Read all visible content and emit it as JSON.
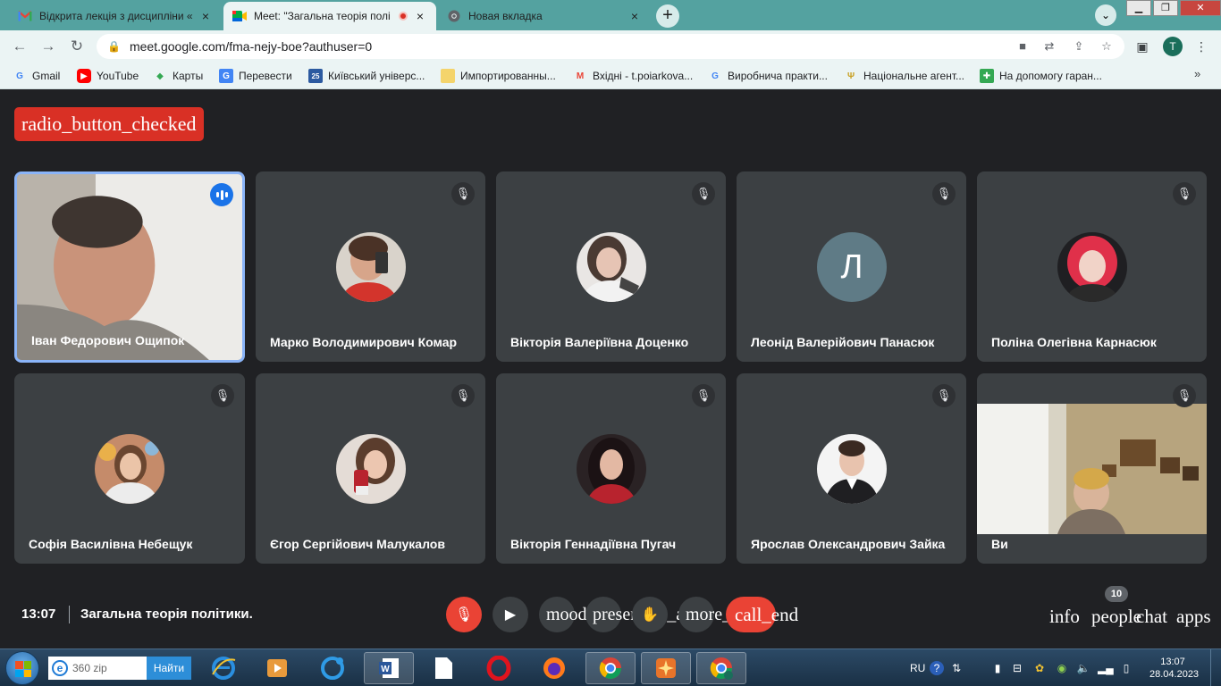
{
  "browser": {
    "tabs": [
      {
        "title": "Відкрита лекція з дисципліни «З",
        "close": "×"
      },
      {
        "title": "Meet: \"Загальна теорія полі",
        "close": "×"
      },
      {
        "title": "Новая вкладка",
        "close": "×"
      }
    ],
    "new_tab": "+",
    "url": "meet.google.com/fma-nejy-boe?authuser=0",
    "profile_initial": "T",
    "bookmarks": [
      {
        "label": "Gmail"
      },
      {
        "label": "YouTube"
      },
      {
        "label": "Карты"
      },
      {
        "label": "Перевести"
      },
      {
        "label": "Київський універс..."
      },
      {
        "label": "Импортированны..."
      },
      {
        "label": "Вхідні - t.poiarkova..."
      },
      {
        "label": "Виробнича практи..."
      },
      {
        "label": "Національне агент..."
      },
      {
        "label": "На допомогу гаран..."
      }
    ],
    "bookmarks_more": "»",
    "colors": {
      "tab_strip": "#54a2a0",
      "toolbar": "#ebf4f4"
    }
  },
  "meet": {
    "recording_badge": "radio_button_checked",
    "participants": [
      {
        "name": "Іван Федорович Ощипок",
        "speaking": true,
        "kind": "video"
      },
      {
        "name": "Марко Володимирович Комар",
        "kind": "photo",
        "photo": "boy-with-phone"
      },
      {
        "name": "Вікторія Валеріївна Доценко",
        "kind": "photo",
        "photo": "girl-dark-hair"
      },
      {
        "name": "Леонід Валерійович Панасюк",
        "kind": "letter",
        "letter": "Л"
      },
      {
        "name": "Поліна Олегівна Карнасюк",
        "kind": "photo",
        "photo": "girl-red-hair"
      },
      {
        "name": "Софія Василівна Небещук",
        "kind": "photo",
        "photo": "girl-smiling"
      },
      {
        "name": "Єгор Сергійович Малукалов",
        "kind": "photo",
        "photo": "girl-with-cup"
      },
      {
        "name": "Вікторія Геннадіївна Пугач",
        "kind": "photo",
        "photo": "woman-dark-hair"
      },
      {
        "name": "Ярослав Олександрович Зайка",
        "kind": "photo",
        "photo": "young-man-suit"
      },
      {
        "name": "Ви",
        "kind": "video"
      }
    ],
    "bottom": {
      "time": "13:07",
      "meeting_title": "Загальна теорія політики.",
      "mood_label": "mood",
      "present_label": "present_to_all",
      "more_label": "more_vert",
      "call_label": "call_end",
      "info_label": "info",
      "people_label": "people",
      "chat_label": "chat",
      "apps_label": "apps",
      "participant_count": "10"
    },
    "colors": {
      "background": "#202124",
      "tile": "#3c4043",
      "danger": "#ea4335",
      "speaking": "#8ab4f8",
      "recording": "#d93025"
    }
  },
  "taskbar": {
    "search_text": "360 zip",
    "search_button": "Найти",
    "lang": "RU",
    "clock_time": "13:07",
    "clock_date": "28.04.2023"
  }
}
